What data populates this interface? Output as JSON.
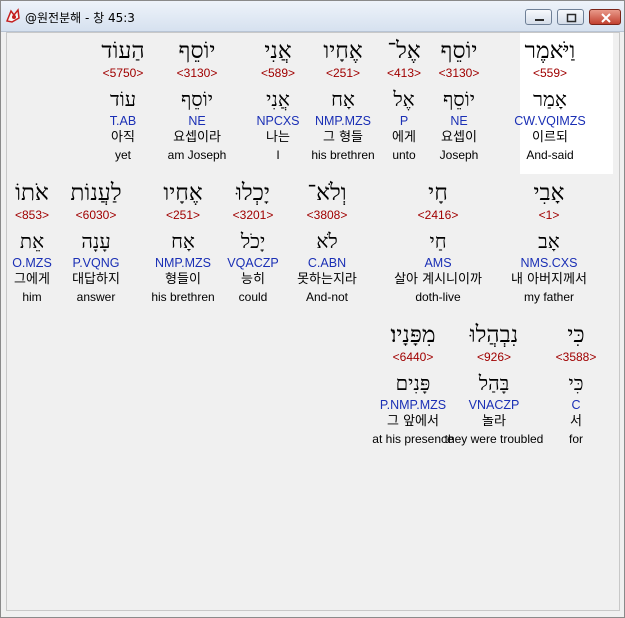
{
  "window": {
    "title": "@원전분해 - 창 45:3",
    "colors": {
      "strong": "#a00000",
      "morph": "#1a2fb5",
      "highlight": "#ffffff",
      "background": "#f0f0f0"
    }
  },
  "rows": [
    [
      {
        "hebrew": "וַיֹּאמֶר",
        "strong": "<559>",
        "lemma": "אָמַר",
        "morph": "CW.VQIMZS",
        "korean": "이르되",
        "english": "And-said"
      },
      {
        "hebrew": "יוֹסֵף",
        "strong": "<3130>",
        "lemma": "יוֹסֵף",
        "morph": "NE",
        "korean": "요셉이",
        "english": "Joseph"
      },
      {
        "hebrew": "אֶל־",
        "strong": "<413>",
        "lemma": "אֶל",
        "morph": "P",
        "korean": "에게",
        "english": "unto"
      },
      {
        "hebrew": "אֶחָיו",
        "strong": "<251>",
        "lemma": "אָח",
        "morph": "NMP.MZS",
        "korean": "그 형들",
        "english": "his brethren"
      },
      {
        "hebrew": "אֲנִי",
        "strong": "<589>",
        "lemma": "אֲנִי",
        "morph": "NPCXS",
        "korean": "나는",
        "english": "I"
      },
      {
        "hebrew": "יוֹסֵף",
        "strong": "<3130>",
        "lemma": "יוֹסֵף",
        "morph": "NE",
        "korean": "요셉이라",
        "english": "am Joseph"
      },
      {
        "hebrew": "הַעוֹד",
        "strong": "<5750>",
        "lemma": "עוֹד",
        "morph": "T.AB",
        "korean": "아직",
        "english": "yet"
      }
    ],
    [
      {
        "hebrew": "אָבִי",
        "strong": "<1>",
        "lemma": "אָב",
        "morph": "NMS.CXS",
        "korean": "내 아버지께서",
        "english": "my father"
      },
      {
        "hebrew": "חָי",
        "strong": "<2416>",
        "lemma": "חַי",
        "morph": "AMS",
        "korean": "살아 계시니이까",
        "english": "doth-live"
      },
      {
        "hebrew": "וְלֹא־",
        "strong": "<3808>",
        "lemma": "לֹא",
        "morph": "C.ABN",
        "korean": "못하는지라",
        "english": "And-not"
      },
      {
        "hebrew": "יָכְלוּ",
        "strong": "<3201>",
        "lemma": "יָכֹל",
        "morph": "VQACZP",
        "korean": "능히",
        "english": "could"
      },
      {
        "hebrew": "אֶחָיו",
        "strong": "<251>",
        "lemma": "אָח",
        "morph": "NMP.MZS",
        "korean": "형들이",
        "english": "his brethren"
      },
      {
        "hebrew": "לַעֲנוֹת",
        "strong": "<6030>",
        "lemma": "עָנָה",
        "morph": "P.VQNG",
        "korean": "대답하지",
        "english": "answer"
      },
      {
        "hebrew": "אֹתוֹ",
        "strong": "<853>",
        "lemma": "אֵת",
        "morph": "O.MZS",
        "korean": "그에게",
        "english": "him"
      }
    ],
    [
      {
        "hebrew": "כִּי",
        "strong": "<3588>",
        "lemma": "כִּי",
        "morph": "C",
        "korean": "서",
        "english": "for"
      },
      {
        "hebrew": "נִבְהֲלוּ",
        "strong": "<926>",
        "lemma": "בָּהַל",
        "morph": "VNACZP",
        "korean": "놀라",
        "english": "they were troubled"
      },
      {
        "hebrew": "מִפָּנָיו׃",
        "strong": "<6440>",
        "lemma": "פָּנִים",
        "morph": "P.NMP.MZS",
        "korean": "그 앞에서",
        "english": "at his presence"
      }
    ]
  ]
}
